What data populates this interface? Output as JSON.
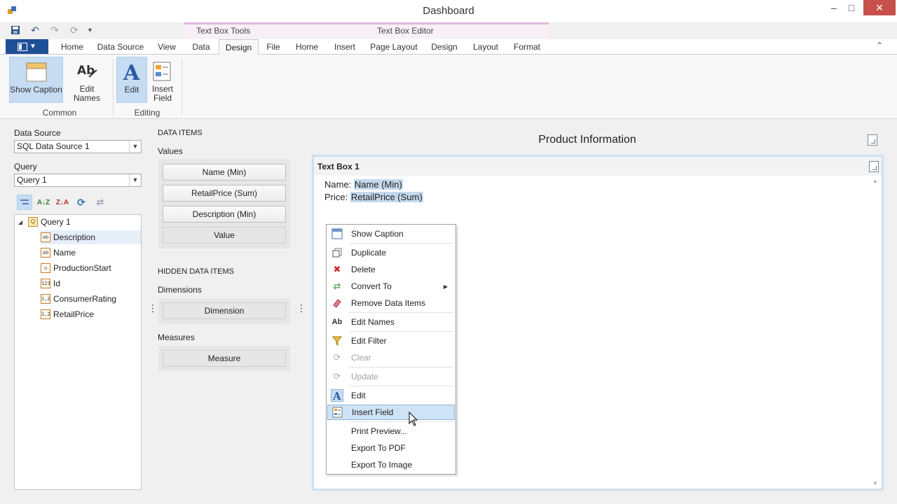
{
  "window": {
    "title": "Dashboard"
  },
  "contextual": {
    "group1": "Text Box Tools",
    "group2": "Text Box Editor"
  },
  "tabs": [
    {
      "label": "Home"
    },
    {
      "label": "Data Source"
    },
    {
      "label": "View"
    },
    {
      "label": "Data"
    },
    {
      "label": "Design"
    },
    {
      "label": "File"
    },
    {
      "label": "Home"
    },
    {
      "label": "Insert"
    },
    {
      "label": "Page Layout"
    },
    {
      "label": "Design"
    },
    {
      "label": "Layout"
    },
    {
      "label": "Format"
    }
  ],
  "ribbon": {
    "show_caption": "Show Caption",
    "edit_names": "Edit Names",
    "group_common": "Common",
    "edit": "Edit",
    "insert_field_1": "Insert",
    "insert_field_2": "Field",
    "group_editing": "Editing"
  },
  "left": {
    "data_source_label": "Data Source",
    "data_source_value": "SQL Data Source 1",
    "query_label": "Query",
    "query_value": "Query 1",
    "tree_root": "Query 1",
    "fields": [
      {
        "name": "Description",
        "type": "ab"
      },
      {
        "name": "Name",
        "type": "ab"
      },
      {
        "name": "ProductionStart",
        "type": "clock"
      },
      {
        "name": "Id",
        "type": "123"
      },
      {
        "name": "ConsumerRating",
        "type": "1,2"
      },
      {
        "name": "RetailPrice",
        "type": "1,2"
      }
    ]
  },
  "data_items": {
    "title": "DATA ITEMS",
    "values_label": "Values",
    "values": [
      "Name (Min)",
      "RetailPrice (Sum)",
      "Description (Min)",
      "Value"
    ],
    "hidden_title": "HIDDEN DATA ITEMS",
    "dimensions_label": "Dimensions",
    "dimension": "Dimension",
    "measures_label": "Measures",
    "measure": "Measure"
  },
  "dashboard": {
    "title": "Product Information",
    "item_caption": "Text Box 1",
    "line1_prefix": "Name: ",
    "line1_field": "Name (Min)",
    "line2_prefix": "Price: ",
    "line2_field": "RetailPrice (Sum)"
  },
  "context_menu": {
    "items": [
      {
        "label": "Show Caption"
      },
      {
        "label": "Duplicate"
      },
      {
        "label": "Delete"
      },
      {
        "label": "Convert To"
      },
      {
        "label": "Remove Data Items"
      },
      {
        "label": "Edit Names"
      },
      {
        "label": "Edit Filter"
      },
      {
        "label": "Clear"
      },
      {
        "label": "Update"
      },
      {
        "label": "Edit"
      },
      {
        "label": "Insert Field"
      },
      {
        "label": "Print Preview..."
      },
      {
        "label": "Export To PDF"
      },
      {
        "label": "Export To Image"
      }
    ]
  },
  "colors": {
    "accent": "#1f4f97",
    "selection": "#c6dcf3",
    "close": "#c7504c",
    "contextual": "#e0b6e0"
  }
}
